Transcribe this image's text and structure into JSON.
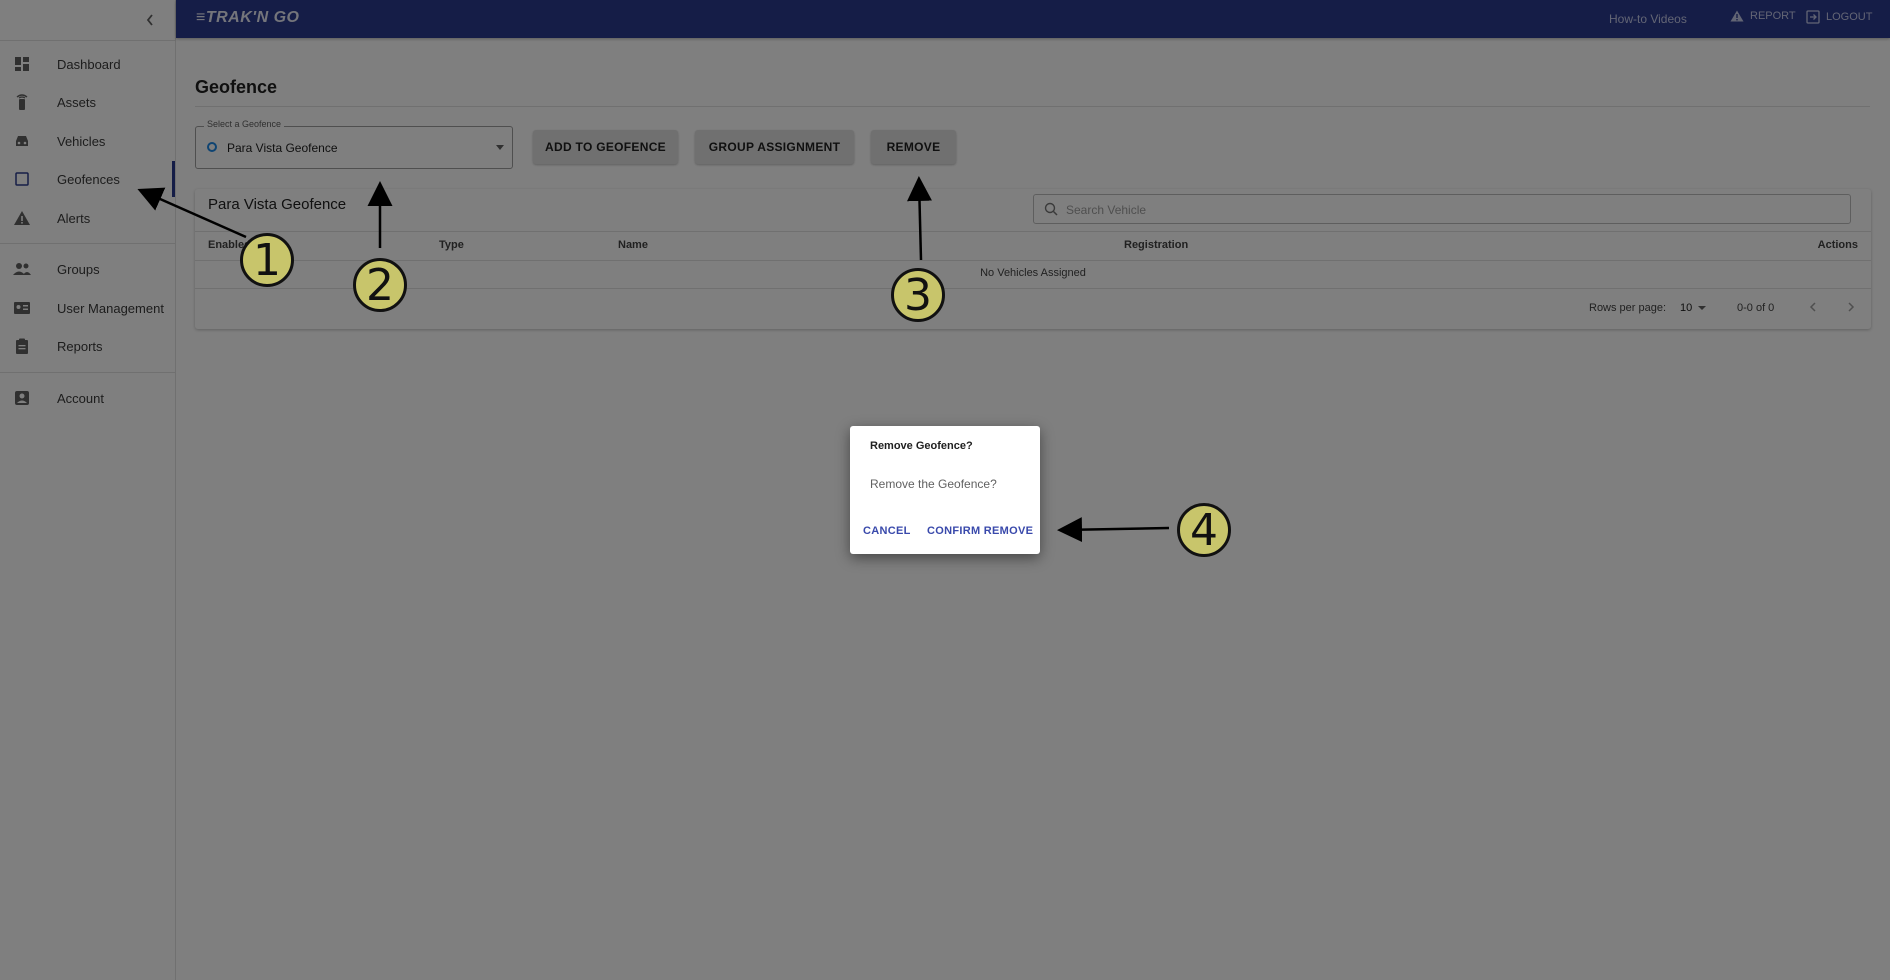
{
  "topbar": {
    "logo": "≡TRAK'N GO",
    "how_to": "How-to Videos",
    "report": "REPORT",
    "logout": "LOGOUT"
  },
  "sidebar": {
    "items": [
      {
        "label": "Dashboard",
        "icon": "dashboard-icon"
      },
      {
        "label": "Assets",
        "icon": "tracker-icon"
      },
      {
        "label": "Vehicles",
        "icon": "car-icon"
      },
      {
        "label": "Geofences",
        "icon": "square-icon",
        "active": true
      },
      {
        "label": "Alerts",
        "icon": "warning-icon"
      },
      {
        "label": "Groups",
        "icon": "people-icon"
      },
      {
        "label": "User Management",
        "icon": "id-card-icon"
      },
      {
        "label": "Reports",
        "icon": "clipboard-icon"
      },
      {
        "label": "Account",
        "icon": "account-box-icon"
      }
    ]
  },
  "main": {
    "title": "Geofence",
    "select": {
      "label": "Select a Geofence",
      "value": "Para Vista Geofence"
    },
    "buttons": {
      "add": "ADD TO GEOFENCE",
      "group": "GROUP ASSIGNMENT",
      "remove": "REMOVE"
    },
    "card": {
      "title": "Para Vista Geofence",
      "search_placeholder": "Search Vehicle",
      "columns": [
        "Enabled",
        "Type",
        "Name",
        "Registration",
        "Actions"
      ],
      "empty": "No Vehicles Assigned",
      "rows_per_page_label": "Rows per page:",
      "rows_per_page": "10",
      "range": "0-0 of 0"
    }
  },
  "dialog": {
    "title": "Remove Geofence?",
    "body": "Remove the Geofence?",
    "cancel": "CANCEL",
    "confirm": "CONFIRM REMOVE"
  },
  "callouts": [
    "1",
    "2",
    "3",
    "4"
  ],
  "colors": {
    "topbar": "#2b3a8f",
    "callout": "#c8c56b",
    "dialog_action": "#3949ab"
  }
}
